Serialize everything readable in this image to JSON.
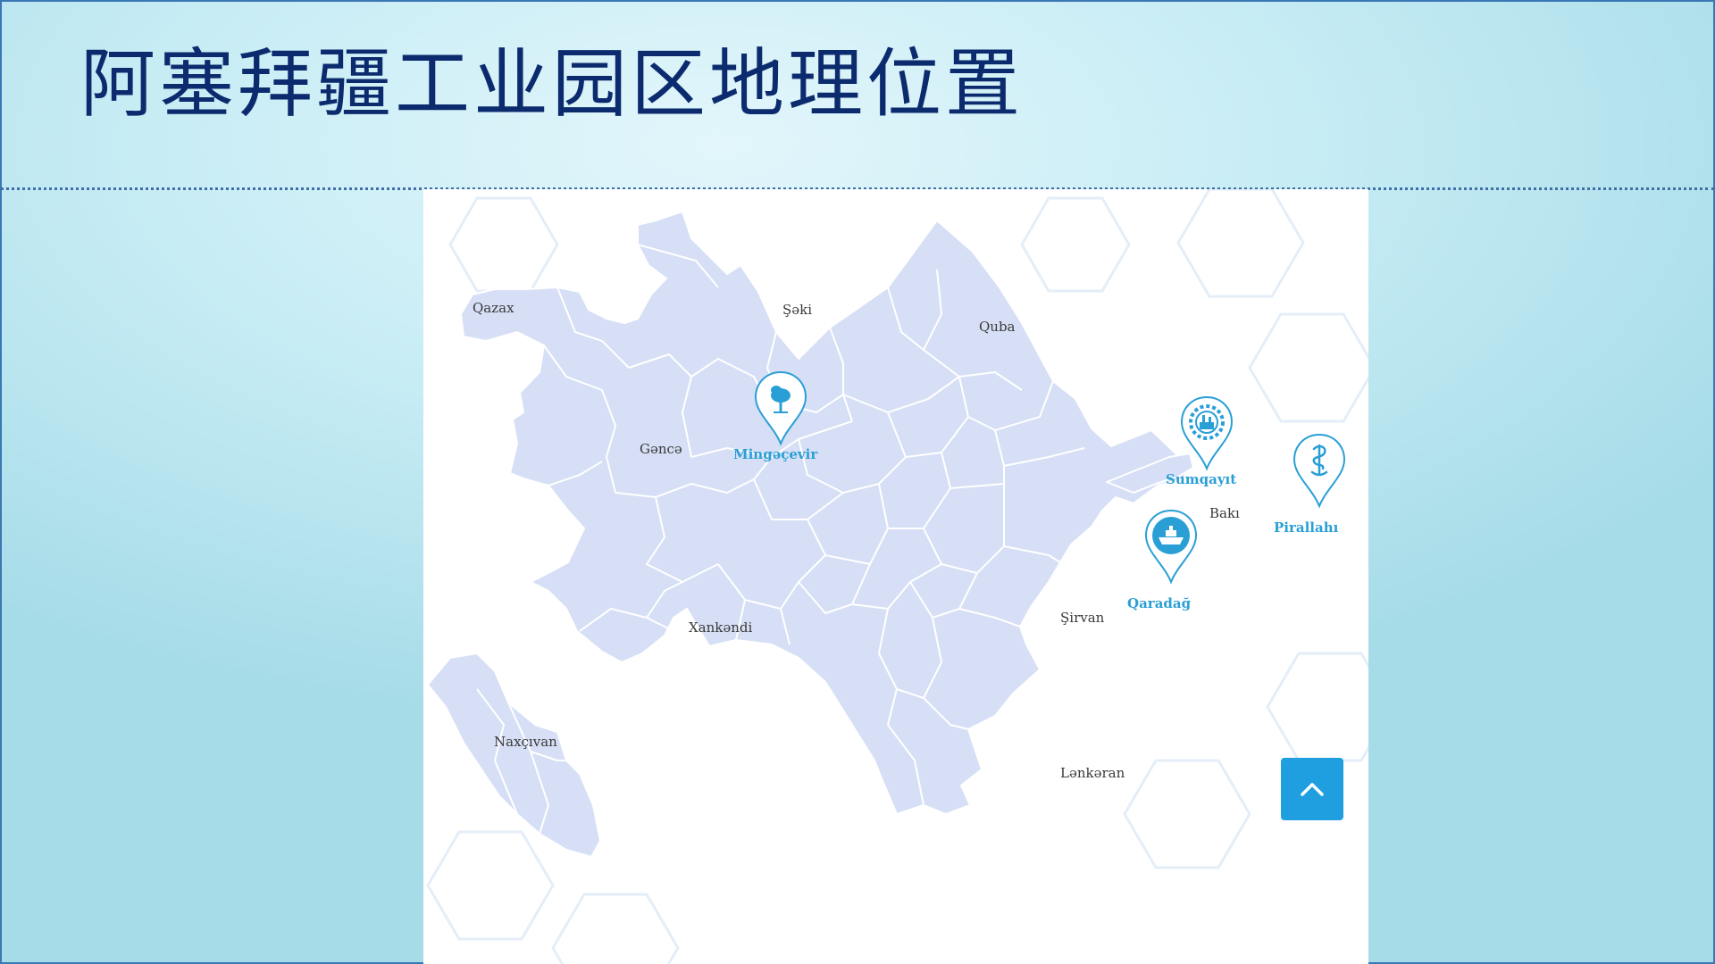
{
  "slide": {
    "title": "阿塞拜疆工业园区地理位置"
  },
  "colors": {
    "title": "#0c2b6e",
    "land": "#d6dff5",
    "border": "#ffffff",
    "marker": "#2a9fd6",
    "button": "#1f9fe0"
  },
  "map": {
    "places": {
      "qazax": "Qazax",
      "seki": "Şəki",
      "quba": "Quba",
      "gence": "Gəncə",
      "baki": "Bakı",
      "xankendi": "Xankəndi",
      "sirvan": "Şirvan",
      "naxcivan": "Naxçıvan",
      "lenkeran": "Lənkəran"
    },
    "industrial_parks": [
      {
        "name": "Mingəçevir",
        "icon": "tree-icon"
      },
      {
        "name": "Sumqayıt",
        "icon": "factory-gear-icon"
      },
      {
        "name": "Qaradağ",
        "icon": "ship-icon"
      },
      {
        "name": "Pirallahı",
        "icon": "pharmacy-snake-icon"
      }
    ]
  },
  "scroll_top_button": {
    "icon": "chevron-up-icon"
  }
}
